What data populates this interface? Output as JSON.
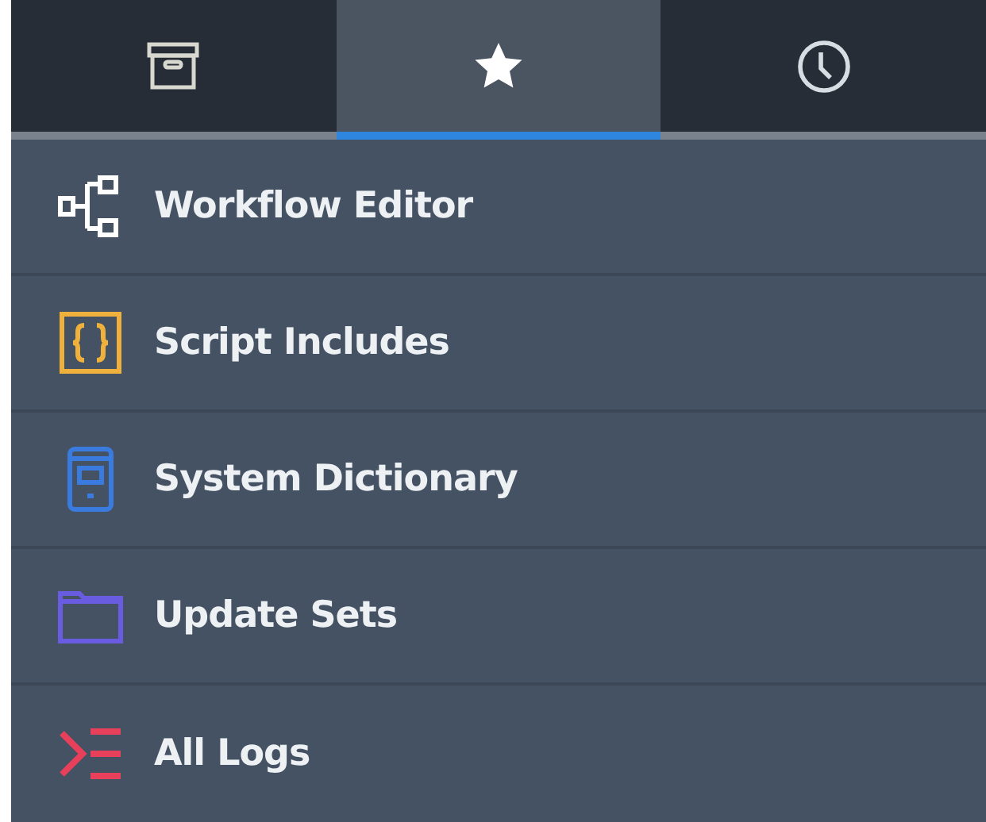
{
  "tabs": [
    {
      "kind": "archive",
      "selected": false
    },
    {
      "kind": "star",
      "selected": true
    },
    {
      "kind": "history",
      "selected": false
    }
  ],
  "items": [
    {
      "label": "Workflow Editor",
      "kind": "workflow",
      "color": "#ffffff"
    },
    {
      "label": "Script Includes",
      "kind": "script",
      "color": "#f0b03c"
    },
    {
      "label": "System Dictionary",
      "kind": "dictionary",
      "color": "#3a7be0"
    },
    {
      "label": "Update Sets",
      "kind": "folder",
      "color": "#6a5ce0"
    },
    {
      "label": "All Logs",
      "kind": "logs",
      "color": "#e8405a"
    }
  ]
}
